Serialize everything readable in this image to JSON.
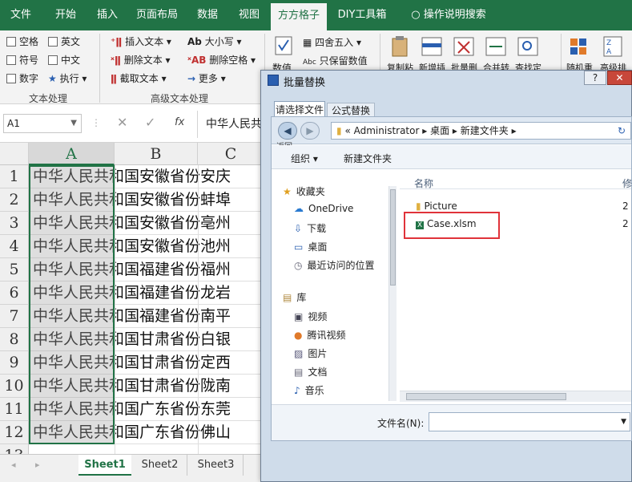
{
  "ribbon_tabs": [
    "文件",
    "开始",
    "插入",
    "页面布局",
    "数据",
    "视图",
    "方方格子",
    "DIY工具箱",
    "操作说明搜索"
  ],
  "ribbon": {
    "checks": [
      "空格",
      "英文",
      "符号",
      "中文",
      "数字"
    ],
    "exec": "执行",
    "adv_buttons": [
      "插入文本",
      "删除文本",
      "截取文本",
      "大小写",
      "删除空格",
      "更多"
    ],
    "num_buttons": [
      "四舍五入",
      "只保留数值",
      "数值"
    ],
    "big_buttons": [
      "复制粘",
      "新增插",
      "批量删",
      "合并转",
      "查找定",
      "随机重",
      "高级排"
    ],
    "group_labels": [
      "文本处理",
      "高级文本处理"
    ]
  },
  "formula": {
    "namebox": "A1",
    "value": "中华人民共"
  },
  "columns": [
    "A",
    "B",
    "C"
  ],
  "rows": [
    {
      "n": "1",
      "text": "中华人民共和国安徽省份安庆"
    },
    {
      "n": "2",
      "text": "中华人民共和国安徽省份蚌埠"
    },
    {
      "n": "3",
      "text": "中华人民共和国安徽省份亳州"
    },
    {
      "n": "4",
      "text": "中华人民共和国安徽省份池州"
    },
    {
      "n": "5",
      "text": "中华人民共和国福建省份福州"
    },
    {
      "n": "6",
      "text": "中华人民共和国福建省份龙岩"
    },
    {
      "n": "7",
      "text": "中华人民共和国福建省份南平"
    },
    {
      "n": "8",
      "text": "中华人民共和国甘肃省份白银"
    },
    {
      "n": "9",
      "text": "中华人民共和国甘肃省份定西"
    },
    {
      "n": "10",
      "text": "中华人民共和国甘肃省份陇南"
    },
    {
      "n": "11",
      "text": "中华人民共和国广东省份东莞"
    },
    {
      "n": "12",
      "text": "中华人民共和国广东省份佛山"
    },
    {
      "n": "13",
      "text": ""
    }
  ],
  "sheets": [
    "Sheet1",
    "Sheet2",
    "Sheet3"
  ],
  "batch_dialog": {
    "title": "批量替换",
    "tabs": [
      "请选择文件",
      "公式替换"
    ]
  },
  "file_dialog": {
    "path": [
      "«",
      "Administrator",
      "桌面",
      "新建文件夹"
    ],
    "back": "返回",
    "organize": "组织",
    "new_folder": "新建文件夹",
    "nav": [
      {
        "label": "收藏夹",
        "icon": "star-icon"
      },
      {
        "label": "OneDrive",
        "icon": "cloud-icon"
      },
      {
        "label": "下载",
        "icon": "download-icon"
      },
      {
        "label": "桌面",
        "icon": "desktop-icon"
      },
      {
        "label": "最近访问的位置",
        "icon": "recent-icon"
      },
      {
        "label": "库",
        "icon": "library-icon"
      },
      {
        "label": "视频",
        "icon": "video-icon"
      },
      {
        "label": "腾讯视频",
        "icon": "tencent-video-icon"
      },
      {
        "label": "图片",
        "icon": "picture-icon"
      },
      {
        "label": "文档",
        "icon": "document-icon"
      },
      {
        "label": "音乐",
        "icon": "music-icon"
      }
    ],
    "col_name": "名称",
    "col_mod": "修",
    "files": [
      {
        "name": "Picture",
        "type": "folder",
        "mod": "2"
      },
      {
        "name": "Case.xlsm",
        "type": "excel",
        "mod": "2"
      }
    ],
    "filename_label": "文件名(N):",
    "filename_value": ""
  },
  "colors": {
    "excel_green": "#217346",
    "highlight_red": "#e0333a"
  }
}
